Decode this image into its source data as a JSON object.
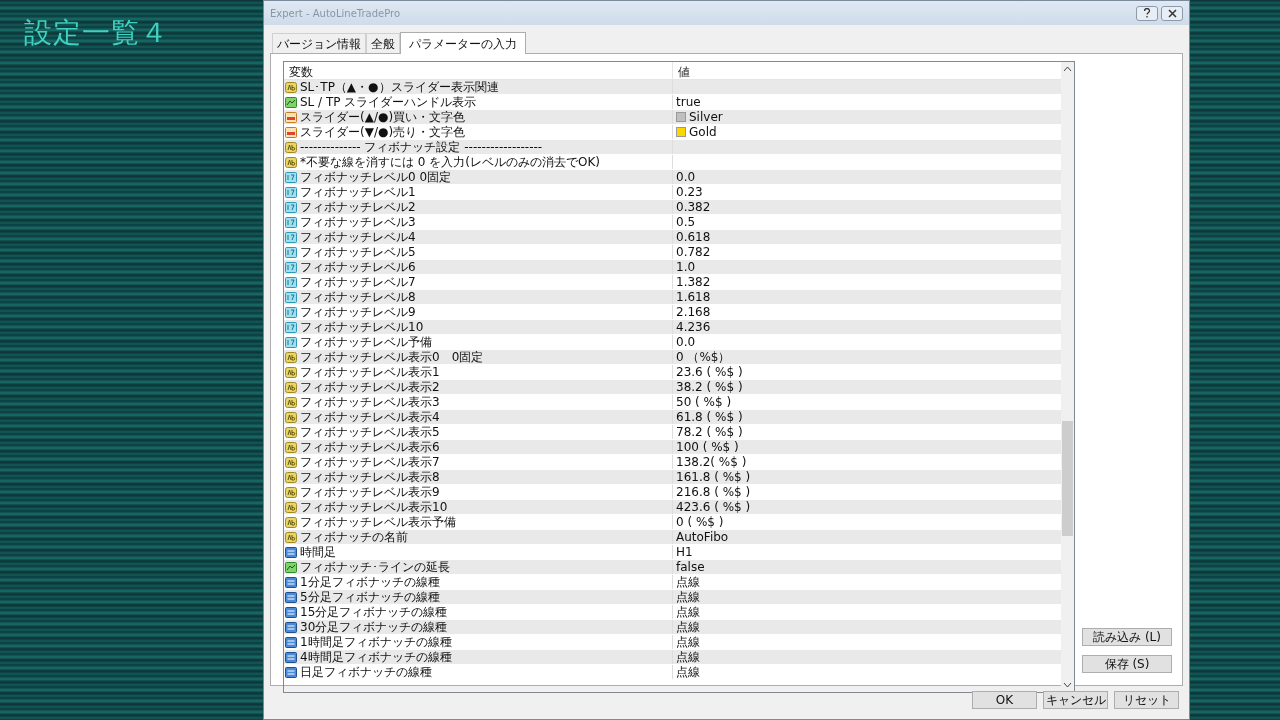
{
  "slide_title": "設定一覧４",
  "window": {
    "title": "Expert - AutoLineTradePro"
  },
  "tabs": [
    {
      "label": "バージョン情報",
      "selected": false
    },
    {
      "label": "全般",
      "selected": false
    },
    {
      "label": "パラメーターの入力",
      "selected": true
    }
  ],
  "table": {
    "columns": [
      "変数",
      "値"
    ],
    "rows": [
      {
        "kind": "string",
        "name": "SL･TP（▲・●）スライダー表示関連",
        "value": ""
      },
      {
        "kind": "bool",
        "name": "SL / TP スライダーハンドル表示",
        "value": "true"
      },
      {
        "kind": "color",
        "name": "スライダー(▲/●)買い・文字色",
        "value": "Silver",
        "color": "#c0c0c0"
      },
      {
        "kind": "color",
        "name": "スライダー(▼/●)売り・文字色",
        "value": "Gold",
        "color": "#ffd700"
      },
      {
        "kind": "string",
        "name": "-------------- フィボナッチ設定 ------------------",
        "value": ""
      },
      {
        "kind": "string",
        "name": "*不要な線を消すには 0 を入力(レベルのみの消去でOK)",
        "value": ""
      },
      {
        "kind": "double",
        "name": "フィボナッチレベル0 0固定",
        "value": "0.0"
      },
      {
        "kind": "double",
        "name": "フィボナッチレベル1",
        "value": "0.23"
      },
      {
        "kind": "double",
        "name": "フィボナッチレベル2",
        "value": "0.382"
      },
      {
        "kind": "double",
        "name": "フィボナッチレベル3",
        "value": "0.5"
      },
      {
        "kind": "double",
        "name": "フィボナッチレベル4",
        "value": "0.618"
      },
      {
        "kind": "double",
        "name": "フィボナッチレベル5",
        "value": "0.782"
      },
      {
        "kind": "double",
        "name": "フィボナッチレベル6",
        "value": "1.0"
      },
      {
        "kind": "double",
        "name": "フィボナッチレベル7",
        "value": "1.382"
      },
      {
        "kind": "double",
        "name": "フィボナッチレベル8",
        "value": "1.618"
      },
      {
        "kind": "double",
        "name": "フィボナッチレベル9",
        "value": "2.168"
      },
      {
        "kind": "double",
        "name": "フィボナッチレベル10",
        "value": "4.236"
      },
      {
        "kind": "double",
        "name": "フィボナッチレベル予備",
        "value": "0.0"
      },
      {
        "kind": "string",
        "name": "フィボナッチレベル表示0　0固定",
        "value": "0 （%$）"
      },
      {
        "kind": "string",
        "name": "フィボナッチレベル表示1",
        "value": "23.6 ( %$ )"
      },
      {
        "kind": "string",
        "name": "フィボナッチレベル表示2",
        "value": "38.2 ( %$ )"
      },
      {
        "kind": "string",
        "name": "フィボナッチレベル表示3",
        "value": "50 ( %$ )"
      },
      {
        "kind": "string",
        "name": "フィボナッチレベル表示4",
        "value": "61.8 ( %$ )"
      },
      {
        "kind": "string",
        "name": "フィボナッチレベル表示5",
        "value": "78.2 ( %$ )"
      },
      {
        "kind": "string",
        "name": "フィボナッチレベル表示6",
        "value": "100 ( %$ )"
      },
      {
        "kind": "string",
        "name": "フィボナッチレベル表示7",
        "value": "138.2( %$ )"
      },
      {
        "kind": "string",
        "name": "フィボナッチレベル表示8",
        "value": "161.8 ( %$ )"
      },
      {
        "kind": "string",
        "name": "フィボナッチレベル表示9",
        "value": "216.8 ( %$ )"
      },
      {
        "kind": "string",
        "name": "フィボナッチレベル表示10",
        "value": "423.6 ( %$ )"
      },
      {
        "kind": "string",
        "name": "フィボナッチレベル表示予備",
        "value": "0 ( %$ )"
      },
      {
        "kind": "string",
        "name": "フィボナッチの名前",
        "value": "AutoFibo"
      },
      {
        "kind": "enum",
        "name": "時間足",
        "value": "H1"
      },
      {
        "kind": "bool",
        "name": "フィボナッチ･ラインの延長",
        "value": "false"
      },
      {
        "kind": "enum",
        "name": "1分足フィボナッチの線種",
        "value": "点線"
      },
      {
        "kind": "enum",
        "name": "5分足フィボナッチの線種",
        "value": "点線"
      },
      {
        "kind": "enum",
        "name": "15分足フィボナッチの線種",
        "value": "点線"
      },
      {
        "kind": "enum",
        "name": "30分足フィボナッチの線種",
        "value": "点線"
      },
      {
        "kind": "enum",
        "name": "1時間足フィボナッチの線種",
        "value": "点線"
      },
      {
        "kind": "enum",
        "name": "4時間足フィボナッチの線種",
        "value": "点線"
      },
      {
        "kind": "enum",
        "name": "日足フィボナッチの線種",
        "value": "点線"
      }
    ]
  },
  "side_buttons": [
    "読み込み (L)",
    "保存 (S)"
  ],
  "buttons": [
    "OK",
    "キャンセル",
    "リセット"
  ]
}
